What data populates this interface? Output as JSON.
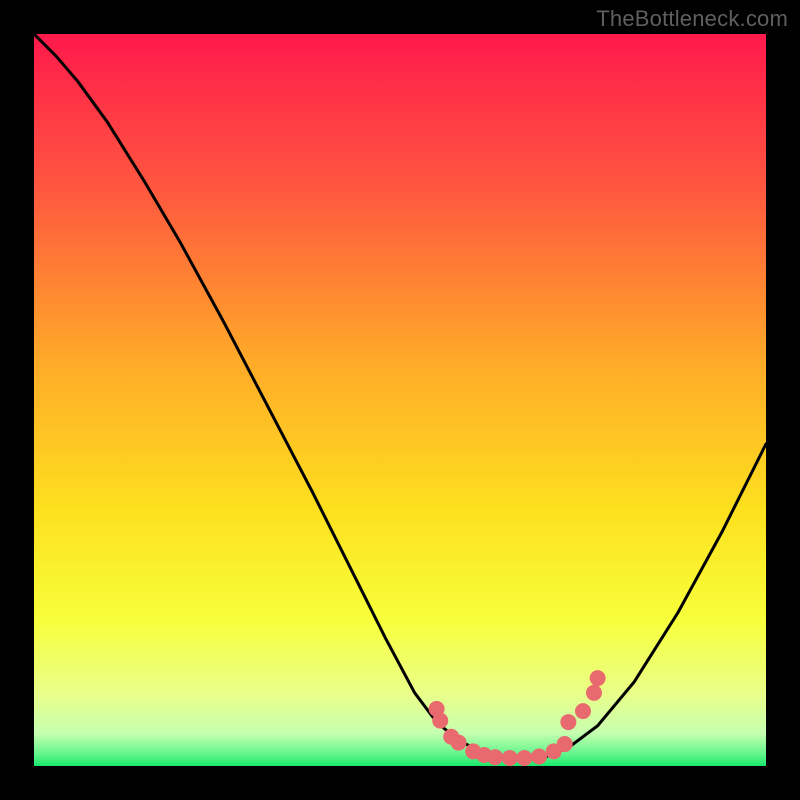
{
  "attribution": "TheBottleneck.com",
  "colors": {
    "background": "#000000",
    "gradient_top": "#ff194c",
    "gradient_mid_upper": "#ff803b",
    "gradient_mid": "#fde01e",
    "gradient_lower": "#f7ff3a",
    "gradient_band": "#eaff89",
    "gradient_bottom": "#17e86a",
    "curve": "#000000",
    "dot": "#e96a6e",
    "attribution_text": "#5f5f5f"
  },
  "chart_data": {
    "type": "line",
    "title": "",
    "xlabel": "",
    "ylabel": "",
    "xlim": [
      0,
      100
    ],
    "ylim": [
      0,
      100
    ],
    "curve": {
      "x": [
        0,
        3,
        6,
        10,
        15,
        20,
        26,
        32,
        38,
        44,
        48,
        52,
        55,
        58,
        61,
        64,
        67,
        70,
        73,
        77,
        82,
        88,
        94,
        100
      ],
      "y": [
        100,
        97,
        93.5,
        88,
        80,
        71.5,
        60.5,
        49,
        37.5,
        25.5,
        17.5,
        10,
        6,
        3.5,
        2,
        1.3,
        1.1,
        1.3,
        2.5,
        5.5,
        11.5,
        21,
        32,
        44
      ]
    },
    "dots": {
      "x": [
        55,
        55.5,
        57,
        58,
        60,
        61.5,
        63,
        65,
        67,
        69,
        71,
        72.5,
        73,
        75,
        76.5,
        77
      ],
      "y": [
        7.8,
        6.2,
        4.0,
        3.2,
        2.0,
        1.5,
        1.2,
        1.1,
        1.1,
        1.3,
        2.0,
        3.0,
        6.0,
        7.5,
        10.0,
        12.0
      ]
    }
  }
}
